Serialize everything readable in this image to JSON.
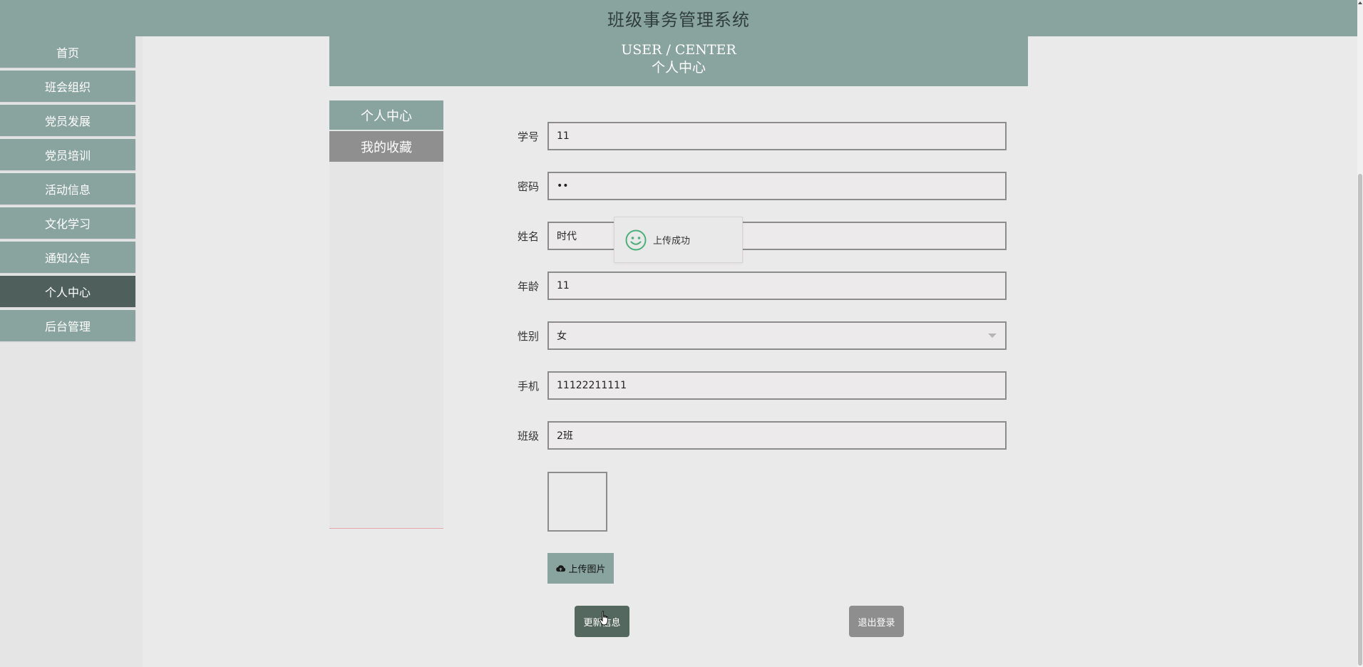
{
  "header": {
    "title": "班级事务管理系统"
  },
  "sidebar": {
    "items": [
      {
        "label": "首页"
      },
      {
        "label": "班会组织"
      },
      {
        "label": "党员发展"
      },
      {
        "label": "党员培训"
      },
      {
        "label": "活动信息"
      },
      {
        "label": "文化学习"
      },
      {
        "label": "通知公告"
      },
      {
        "label": "个人中心",
        "active": true
      },
      {
        "label": "后台管理"
      }
    ]
  },
  "banner": {
    "en": "USER / CENTER",
    "zh": "个人中心"
  },
  "submenu": {
    "items": [
      {
        "label": "个人中心"
      },
      {
        "label": "我的收藏"
      }
    ]
  },
  "form": {
    "student_id": {
      "label": "学号",
      "value": "11"
    },
    "password": {
      "label": "密码",
      "value": "11"
    },
    "name": {
      "label": "姓名",
      "value": "时代"
    },
    "age": {
      "label": "年龄",
      "value": "11"
    },
    "gender": {
      "label": "性别",
      "value": "女"
    },
    "phone": {
      "label": "手机",
      "value": "11122211111"
    },
    "class": {
      "label": "班级",
      "value": "2班"
    }
  },
  "buttons": {
    "upload_image": "上传图片",
    "update_info": "更新信息",
    "logout": "退出登录"
  },
  "toast": {
    "message": "上传成功",
    "icon": "smile-icon"
  },
  "colors": {
    "primary": "#89a49e",
    "active": "#4f605c",
    "update_button": "#55685f",
    "logout_button": "#8e8e8e",
    "toast_icon": "#4caf7a"
  }
}
